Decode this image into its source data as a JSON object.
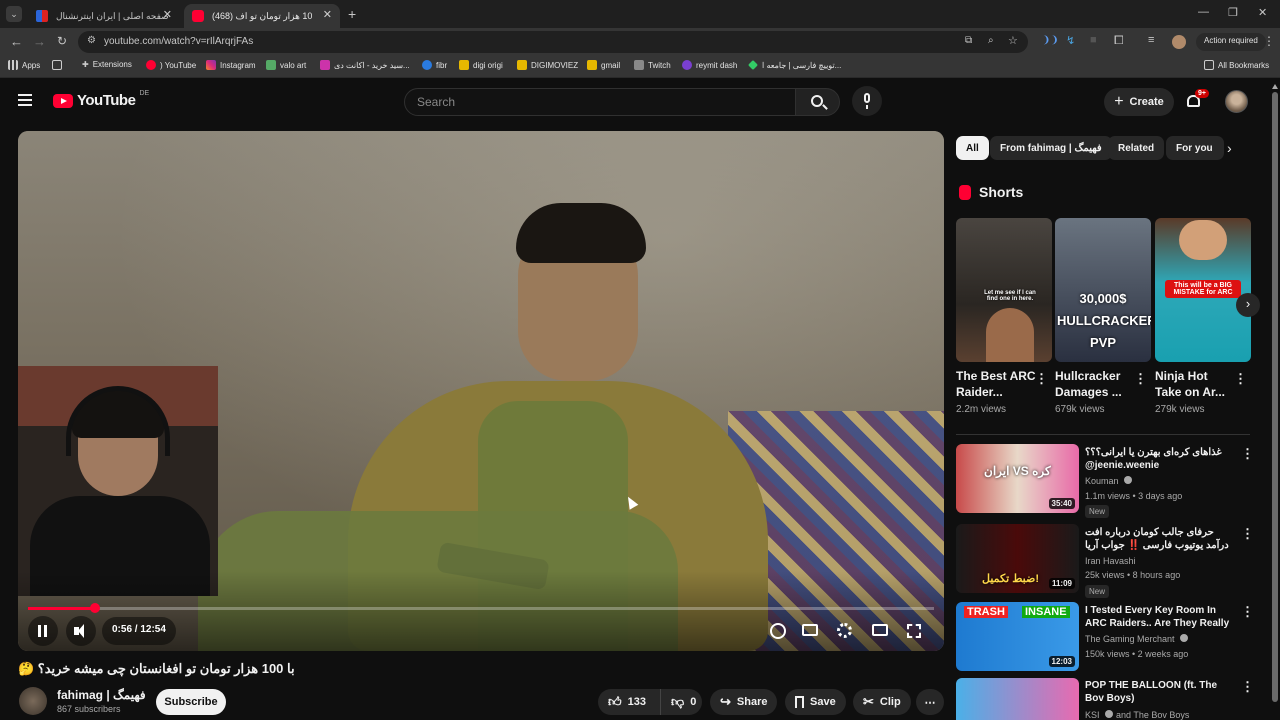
{
  "browser": {
    "tabs": [
      {
        "title": "صفحه اصلی | ایران اینترنشنال",
        "active": false
      },
      {
        "title": "(468) با 100 هزار تومان تو اف...",
        "active": true
      }
    ],
    "url": "youtube.com/watch?v=rIlArqrjFAs",
    "action_required": "Action required",
    "bookmarks": [
      "Apps",
      "Extensions",
      ") YouTube",
      "Instagram",
      "valo art",
      "سید خرید - اکانت دی...",
      "fibr",
      "digi origi",
      "DIGIMOVIEZ",
      "gmail",
      "Twitch",
      "reymit dash",
      "توییچ فارسی | جامعه ا...",
      "All Bookmarks"
    ]
  },
  "youtube": {
    "logo_text": "YouTube",
    "region": "DE",
    "search_placeholder": "Search",
    "create_label": "Create",
    "notification_count": "9+"
  },
  "player": {
    "time": "0:56 / 12:54",
    "progress": 0.074
  },
  "video": {
    "title": "با 100 هزار تومان تو افغانستان چی میشه خرید؟ 🤔",
    "channel": "fahimag | فهیمگ",
    "subscribers": "867 subscribers",
    "subscribe_label": "Subscribe",
    "likes": "133",
    "dislikes": "0",
    "share_label": "Share",
    "save_label": "Save",
    "clip_label": "Clip"
  },
  "chips": [
    "All",
    "From fahimag | فهیمگ",
    "Related",
    "For you"
  ],
  "shorts": {
    "heading": "Shorts",
    "items": [
      {
        "title": "The Best ARC Raider...",
        "views": "2.2m views",
        "overlay": "Let me see if I can find one in here."
      },
      {
        "title": "Hullcracker Damages ...",
        "views": "679k views",
        "overlay": "30,000$ HULLCRACKER PVP"
      },
      {
        "title": "Ninja Hot Take on Ar...",
        "views": "279k views",
        "overlay": "This will be a BIG MISTAKE for ARC"
      }
    ]
  },
  "recommendations": [
    {
      "title": "غذاهای کره‌ای بهترن یا ایرانی؟؟؟ jeenie.weenie@",
      "channel": "Kouman",
      "meta": "1.1m views • 3 days ago",
      "duration": "35:40",
      "new": "New",
      "verified": true,
      "overlay": "ایران VS کره"
    },
    {
      "title": "حرفای جالب کومان درباره افت درآمد یوتیوب فارسی ‼️ جواب آریا کئوکسر به ...",
      "channel": "Iran Havashi",
      "meta": "25k views • 8 hours ago",
      "duration": "11:09",
      "new": "New",
      "verified": false,
      "overlay": "ضبط تکمیل!"
    },
    {
      "title": "I Tested Every Key Room In ARC Raiders.. Are They Really THA...",
      "channel": "The Gaming Merchant",
      "meta": "150k views • 2 weeks ago",
      "duration": "12:03",
      "new": "",
      "verified": true,
      "overlay_left": "TRASH",
      "overlay_right": "INSANE"
    },
    {
      "title": "POP THE BALLOON (ft. The Bov Boys)",
      "channel": "KSI",
      "meta": "and The Bov Boys",
      "duration": "",
      "new": "",
      "verified": true
    }
  ],
  "colors": {
    "brand_red": "#ff0033",
    "bg": "#0f0f0f",
    "chip_bg": "#272727"
  }
}
